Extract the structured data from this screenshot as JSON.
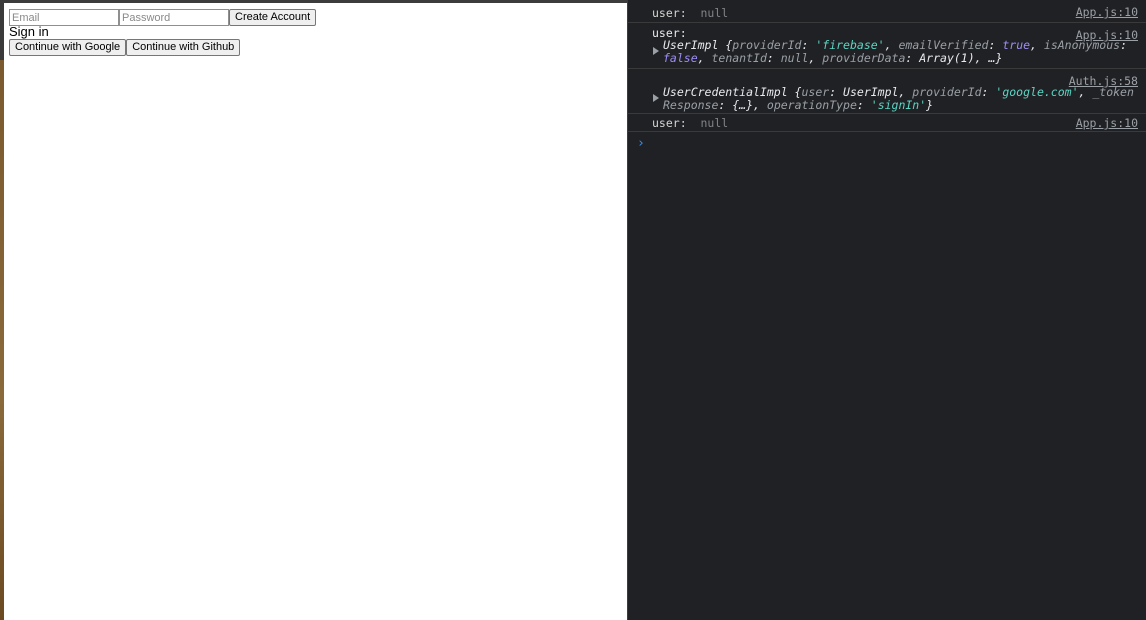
{
  "form": {
    "email_placeholder": "Email",
    "password_placeholder": "Password",
    "create_account_label": "Create Account"
  },
  "signin": {
    "title": "Sign in",
    "google_label": "Continue with Google",
    "github_label": "Continue with Github"
  },
  "console": {
    "entries": [
      {
        "source": "App.js:10",
        "key": "user:",
        "value": "null"
      },
      {
        "source": "App.js:10",
        "key": "user:",
        "object": {
          "class": "UserImpl",
          "t1": "providerId",
          "v1": "'firebase'",
          "t2": "emailVerified",
          "v2": "true",
          "t3": "isAnonymous",
          "v3": "false",
          "t4": "tenantId",
          "v4": "null",
          "t5": "providerData",
          "v5": "Array(1)",
          "ellipsis": "…"
        }
      },
      {
        "source": "Auth.js:58",
        "object": {
          "class": "UserCredentialImpl",
          "t1": "user",
          "v1": "UserImpl",
          "t2": "providerId",
          "v2": "'google.com'",
          "t3": "_tokenResponse",
          "v3": "{…}",
          "t4": "operationType",
          "v4": "'signIn'"
        }
      },
      {
        "source": "App.js:10",
        "key": "user:",
        "value": "null"
      }
    ],
    "prompt_symbol": "›"
  },
  "colors": {
    "console_bg": "#202124",
    "string": "#5cd5c3",
    "boolean": "#9e8cf7",
    "prompt": "#3b8eea"
  }
}
